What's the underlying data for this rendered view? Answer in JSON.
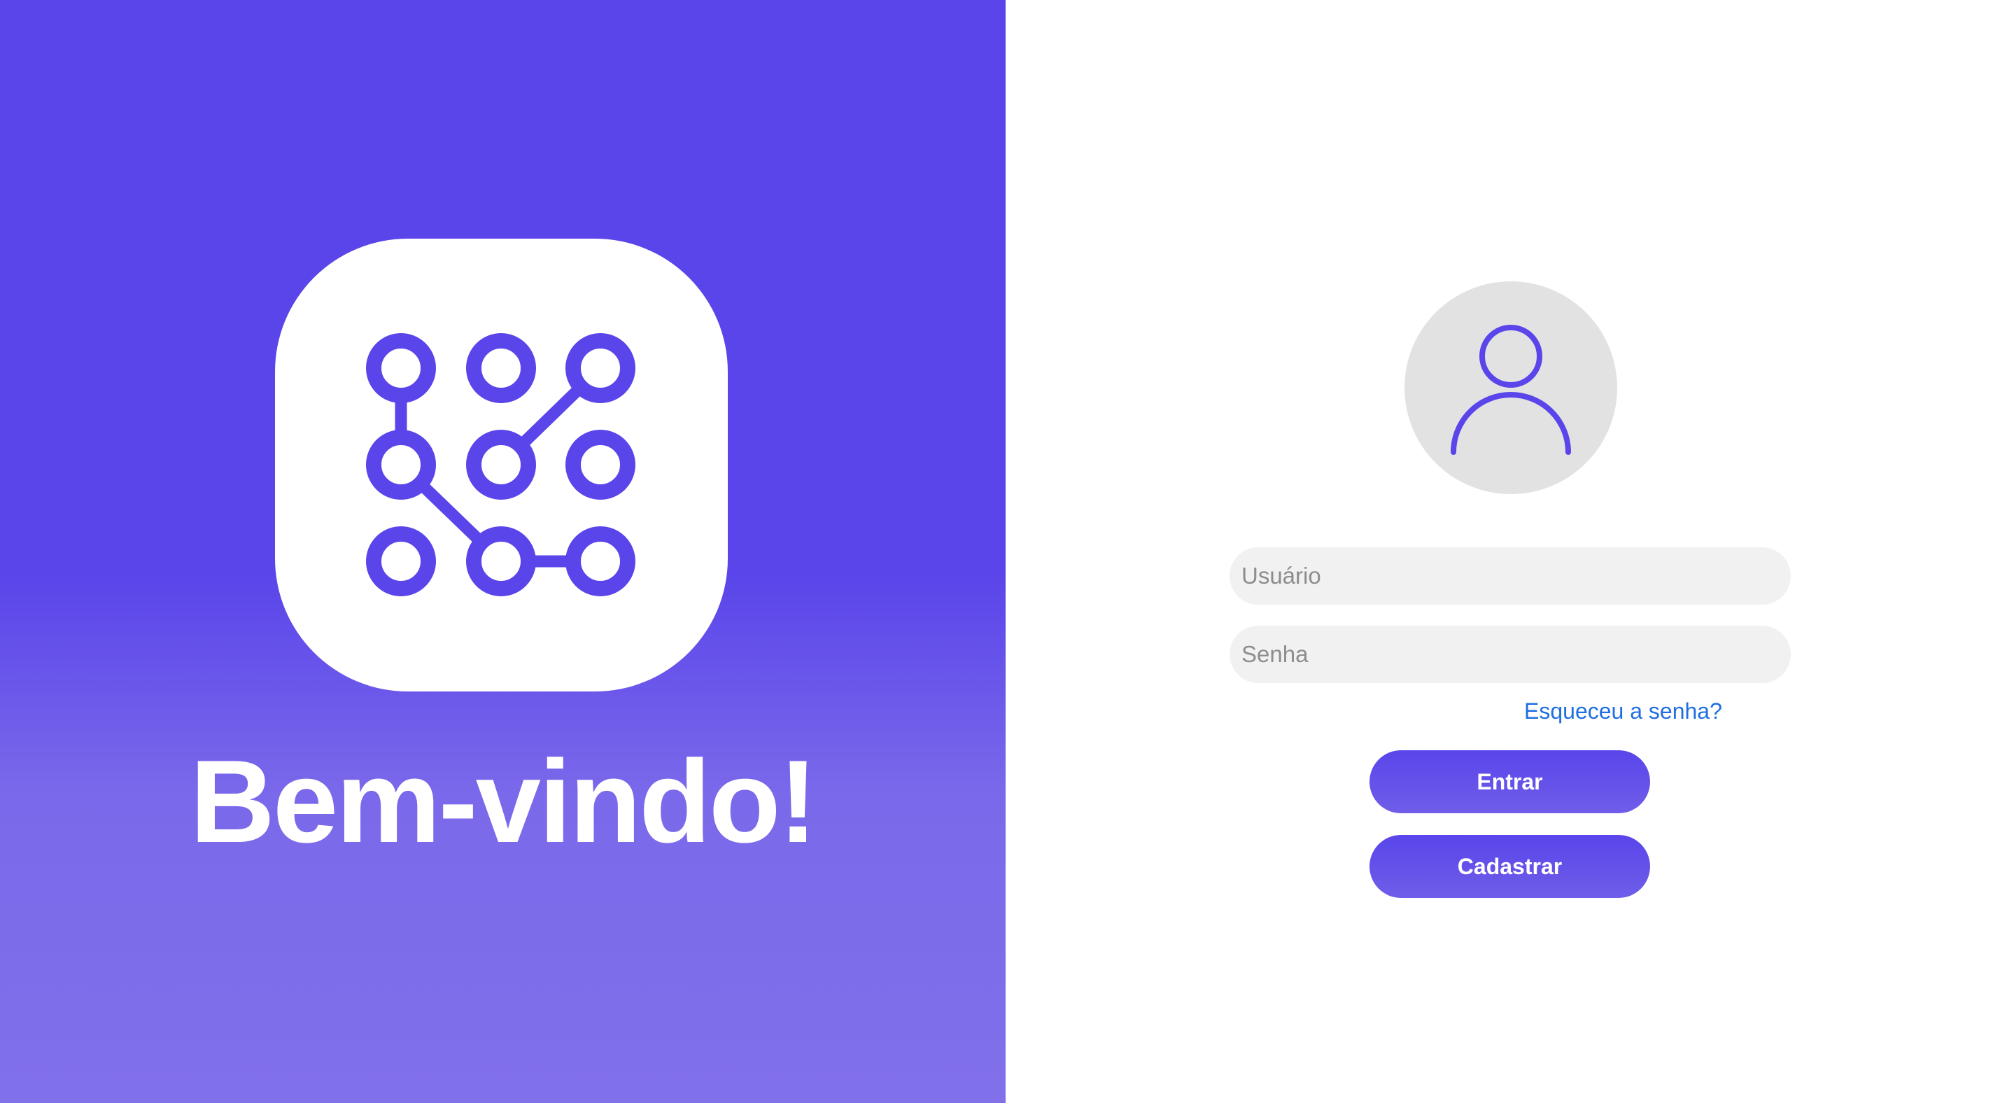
{
  "welcome": {
    "title": "Bem-vindo!",
    "logo_icon": "pattern-lock-icon"
  },
  "login": {
    "avatar_icon": "user-icon",
    "username_placeholder": "Usuário",
    "password_placeholder": "Senha",
    "forgot_password_label": "Esqueceu a senha?",
    "login_button_label": "Entrar",
    "register_button_label": "Cadastrar"
  },
  "colors": {
    "brand_purple": "#5a45ea",
    "brand_purple_light": "#8070e9",
    "link_blue": "#1f6fe0",
    "field_background": "#f1f1f1",
    "avatar_background": "#e2e2e2"
  }
}
